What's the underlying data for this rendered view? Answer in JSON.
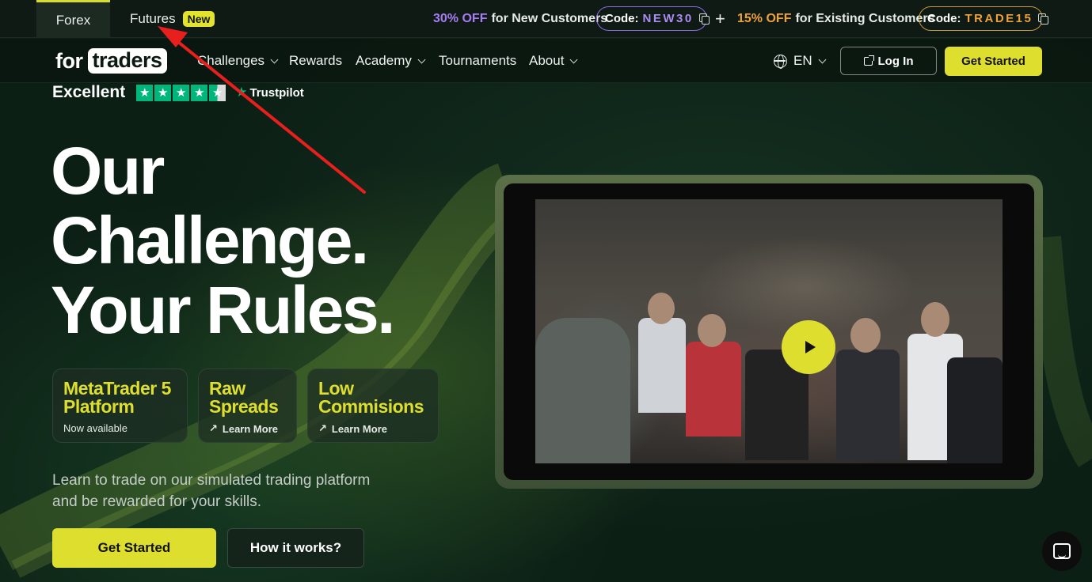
{
  "topbar": {
    "tabs": [
      {
        "label": "Forex",
        "active": true
      },
      {
        "label": "Futures",
        "badge": "New"
      }
    ],
    "promo_new": {
      "pct": "30% OFF",
      "text": "for New Customers",
      "code_label": "Code:",
      "code": "NEW30"
    },
    "promo_existing": {
      "pct": "15% OFF",
      "text": "for Existing Customers",
      "code_label": "Code:",
      "code": "TRADE15"
    }
  },
  "nav": {
    "logo_prefix": "for",
    "logo_box": "traders",
    "items": [
      {
        "label": "Challenges",
        "dropdown": true
      },
      {
        "label": "Rewards",
        "dropdown": false
      },
      {
        "label": "Academy",
        "dropdown": true
      },
      {
        "label": "Tournaments",
        "dropdown": false
      },
      {
        "label": "About",
        "dropdown": true
      }
    ],
    "language": "EN",
    "login": "Log In",
    "cta": "Get Started"
  },
  "trust": {
    "label": "Excellent",
    "brand": "Trustpilot",
    "rating": 4.5
  },
  "hero": {
    "title_lines": [
      "Our",
      "Challenge.",
      "Your Rules."
    ],
    "features": [
      {
        "title_lines": [
          "MetaTrader 5",
          "Platform"
        ],
        "sub": "Now available"
      },
      {
        "title_lines": [
          "Raw",
          "Spreads"
        ],
        "sub": "Learn More"
      },
      {
        "title_lines": [
          "Low",
          "Commisions"
        ],
        "sub": "Learn More"
      }
    ],
    "desc_lines": [
      "Learn to trade on our simulated trading platform",
      "and be rewarded for your skills."
    ],
    "cta": "Get Started",
    "secondary": "How it works?"
  },
  "colors": {
    "accent": "#dede2f",
    "background": "#0c1a12",
    "purple": "#a77df4",
    "orange": "#f0a23a",
    "trustpilot": "#00b67a"
  },
  "icons": [
    "copy-icon",
    "plus-icon",
    "globe-icon",
    "external-link-icon",
    "star-icon",
    "arrow-up-right-icon",
    "play-icon",
    "chat-icon"
  ]
}
